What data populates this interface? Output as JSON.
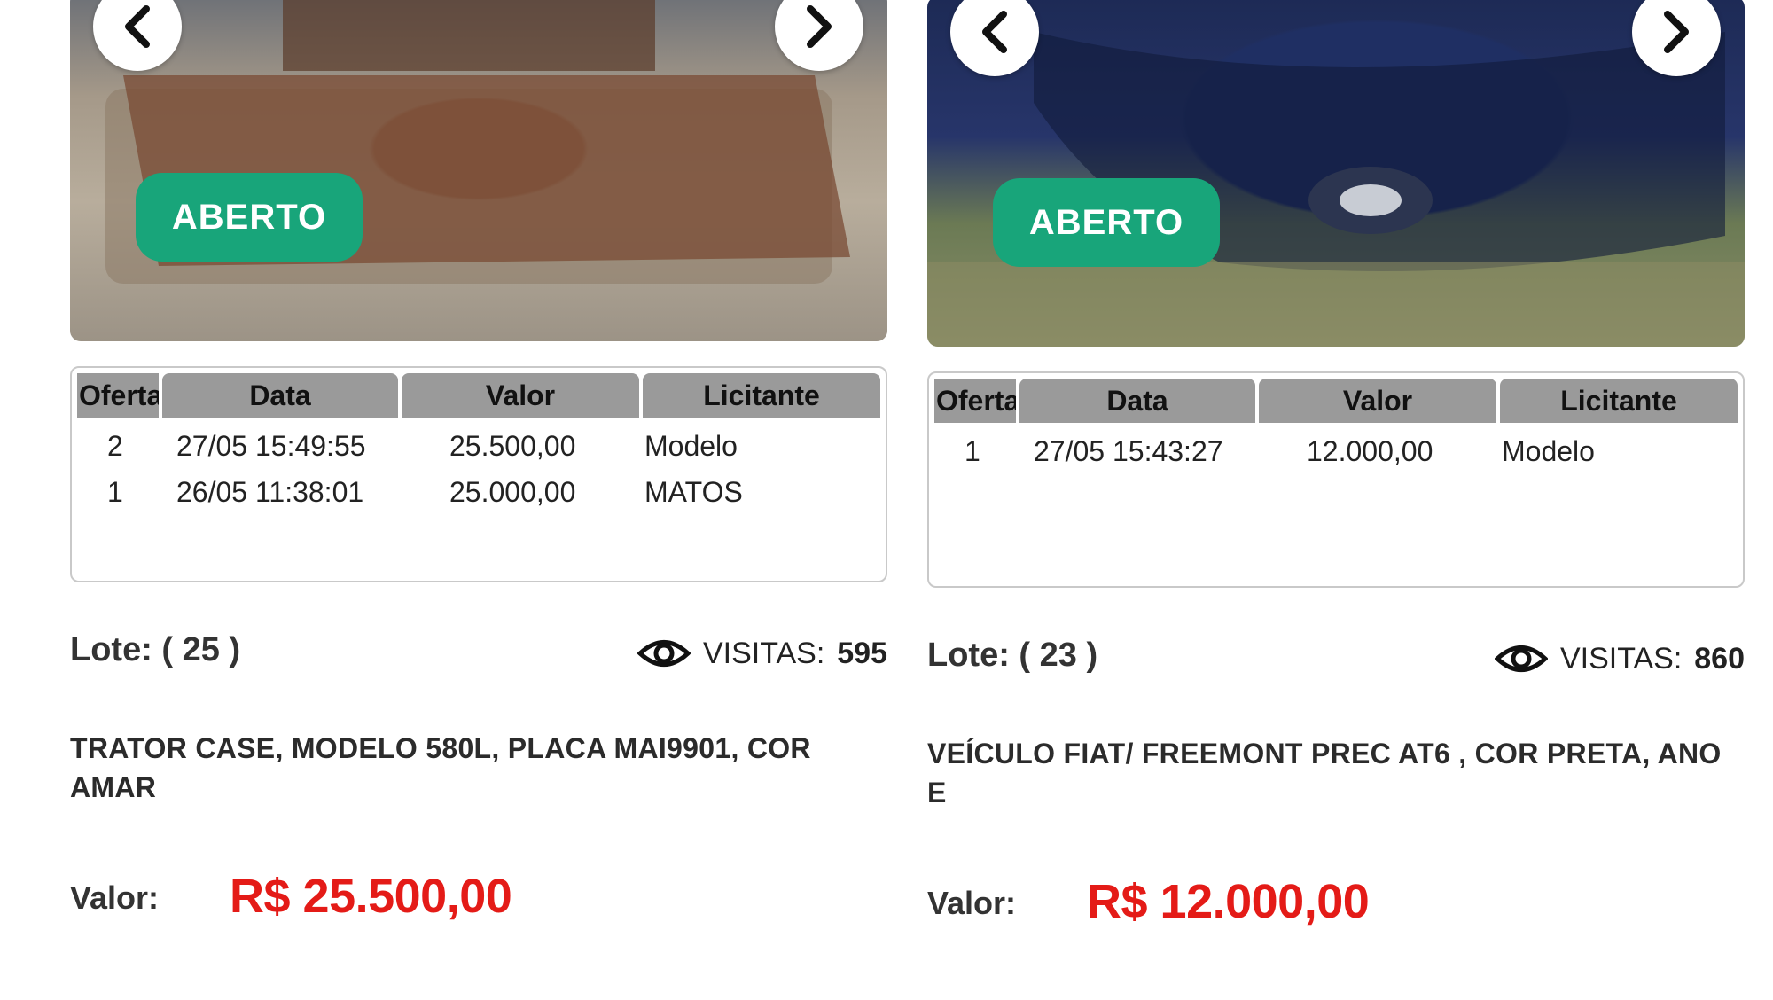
{
  "colors": {
    "badge": "#18a57a",
    "price": "#e41b17",
    "table_header": "#9a9a9a"
  },
  "table_headers": [
    "Oferta",
    "Data",
    "Valor",
    "Licitante"
  ],
  "cards": [
    {
      "photo_icons": {
        "prev": "chevron-left-icon",
        "next": "chevron-right-icon"
      },
      "status": "ABERTO",
      "bids": [
        {
          "oferta": "2",
          "data": "27/05 15:49:55",
          "valor": "25.500,00",
          "licitante": "Modelo"
        },
        {
          "oferta": "1",
          "data": "26/05 11:38:01",
          "valor": "25.000,00",
          "licitante": "MATOS"
        }
      ],
      "lote_label": "Lote: ( 25 )",
      "visits_label": "VISITAS:",
      "visits": "595",
      "description": "TRATOR CASE, MODELO 580L, PLACA MAI9901, COR AMAR",
      "valor_label": "Valor:",
      "valor": "R$ 25.500,00"
    },
    {
      "photo_icons": {
        "prev": "chevron-left-icon",
        "next": "chevron-right-icon"
      },
      "status": "ABERTO",
      "bids": [
        {
          "oferta": "1",
          "data": "27/05 15:43:27",
          "valor": "12.000,00",
          "licitante": "Modelo"
        }
      ],
      "lote_label": "Lote: ( 23 )",
      "visits_label": "VISITAS:",
      "visits": "860",
      "description": "VEÍCULO FIAT/ FREEMONT PREC AT6 , COR PRETA, ANO E",
      "valor_label": "Valor:",
      "valor": "R$ 12.000,00"
    }
  ]
}
